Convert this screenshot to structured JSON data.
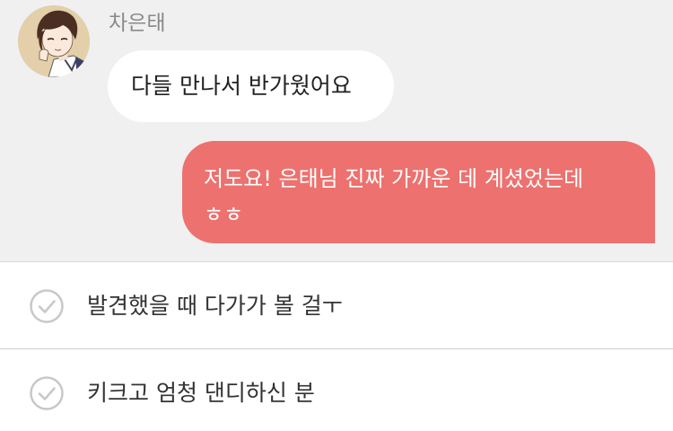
{
  "chat": {
    "sender_name": "차은태",
    "avatar_icon": "profile-avatar",
    "received_message": "다들 만나서 반가웠어요",
    "sent_message_lines": [
      "저도요! 은태님 진짜 가까운 데 계셨었는데",
      "ㅎㅎ"
    ],
    "colors": {
      "chat_background": "#f0f0f0",
      "received_bubble": "#ffffff",
      "sent_bubble": "#ed716e"
    }
  },
  "choices": [
    {
      "label": "발견했을 때 다가가 볼 걸ㅜ",
      "icon": "check-circle-icon"
    },
    {
      "label": "키크고 엄청 댄디하신 분",
      "icon": "check-circle-icon"
    }
  ]
}
